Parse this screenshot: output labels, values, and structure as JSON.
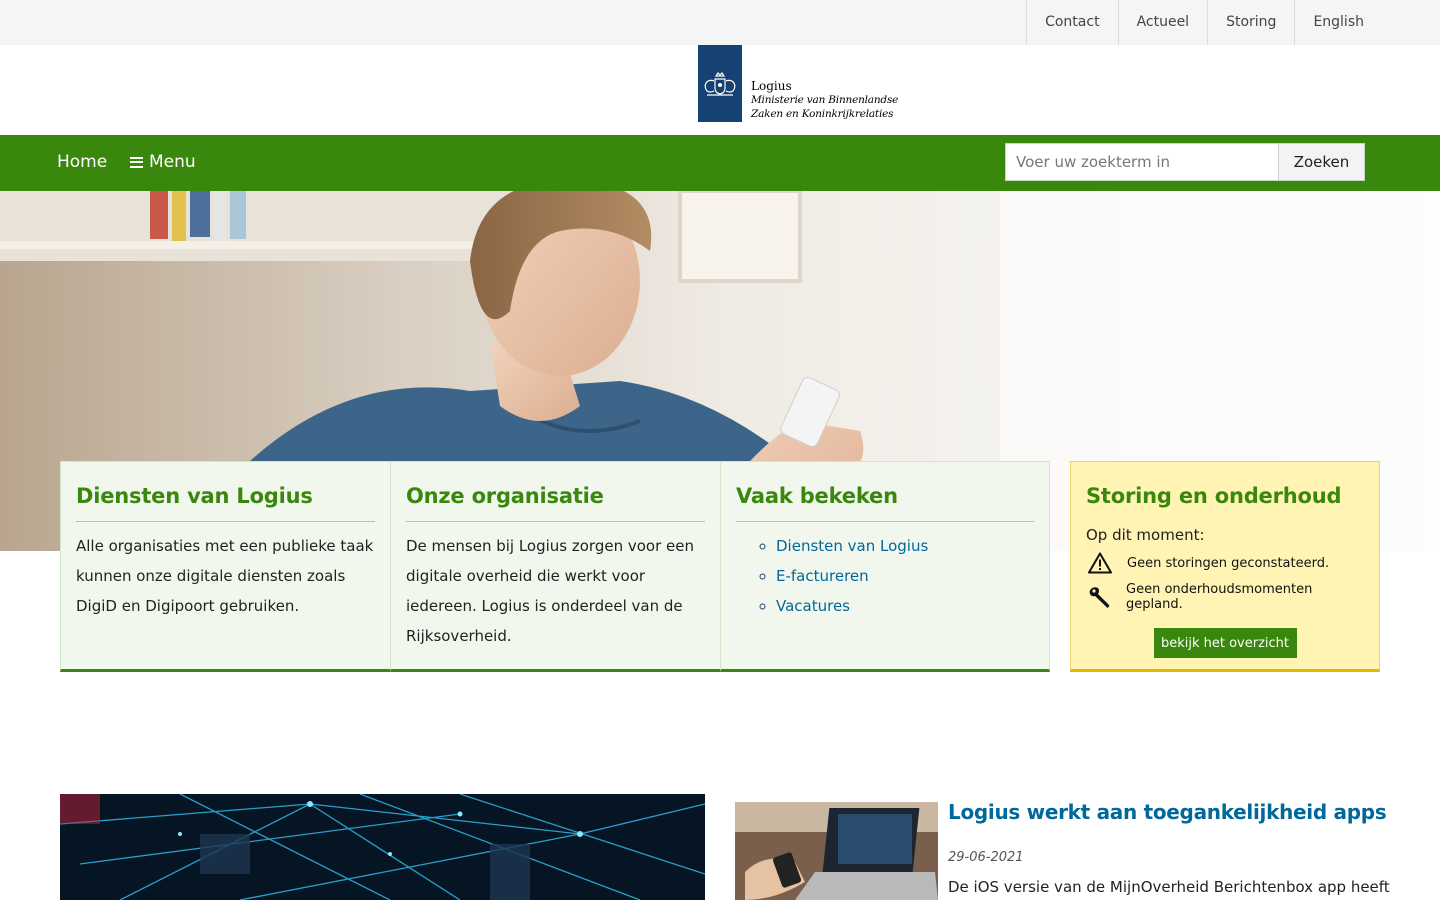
{
  "topbar": {
    "links": [
      "Contact",
      "Actueel",
      "Storing",
      "English"
    ]
  },
  "logo": {
    "org": "Logius",
    "ministry": "Ministerie van Binnenlandse Zaken en Koninkrijkrelaties",
    "emblem_icon": "royal-coat-of-arms-icon",
    "emblem_color": "#154273"
  },
  "nav": {
    "home": "Home",
    "menu": "Menu",
    "search_placeholder": "Voer uw zoekterm in",
    "search_button": "Zoeken",
    "color": "#39870c"
  },
  "cards": [
    {
      "title": "Diensten van Logius",
      "text": "Alle organisaties met een publieke taak kunnen onze digitale diensten zoals DigiD en Digipoort gebruiken."
    },
    {
      "title": "Onze organisatie",
      "text": "De mensen bij Logius zorgen voor een digitale overheid die werkt voor iedereen. Logius is onderdeel van de Rijksoverheid."
    },
    {
      "title": "Vaak bekeken",
      "links": [
        "Diensten van Logius",
        "E-factureren",
        "Vacatures"
      ]
    }
  ],
  "status": {
    "title": "Storing en onderhoud",
    "now": "Op dit moment:",
    "outages": "Geen storingen geconstateerd.",
    "maintenance": "Geen onderhoudsmomenten gepland.",
    "button": "bekijk het overzicht"
  },
  "news": {
    "title": "Logius werkt aan toegankelijkheid apps",
    "date": "29-06-2021",
    "excerpt": "De iOS versie van de MijnOverheid Berichtenbox app heeft"
  }
}
